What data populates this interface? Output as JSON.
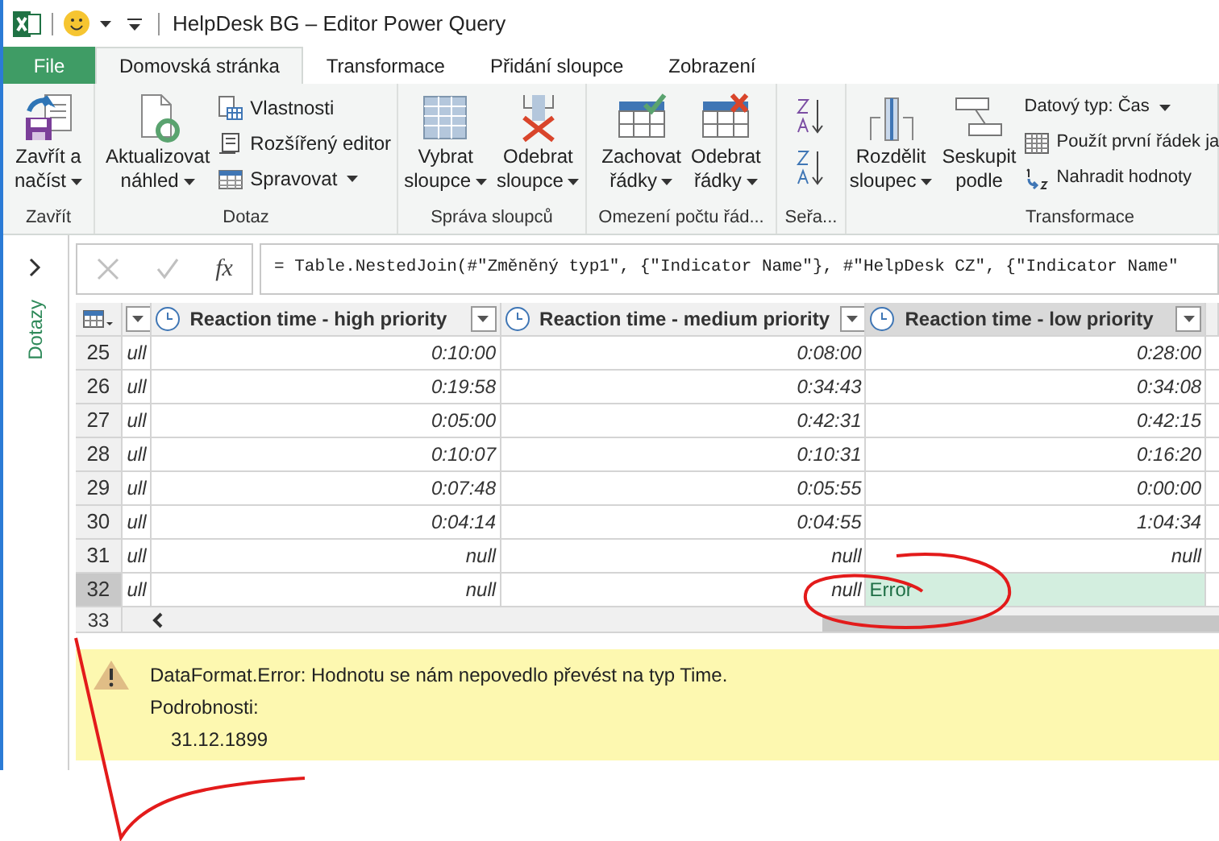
{
  "window": {
    "title": "HelpDesk BG – Editor Power Query"
  },
  "tabs": [
    {
      "label": "File",
      "kind": "file",
      "selected": false
    },
    {
      "label": "Domovská stránka",
      "kind": "tab",
      "selected": true
    },
    {
      "label": "Transformace",
      "kind": "tab",
      "selected": false
    },
    {
      "label": "Přidání sloupce",
      "kind": "tab",
      "selected": false
    },
    {
      "label": "Zobrazení",
      "kind": "tab",
      "selected": false
    }
  ],
  "ribbon": [
    {
      "label": "Zavřít",
      "items": [
        {
          "kind": "large",
          "lines": [
            "Zavřít a",
            "načíst"
          ],
          "dropdown": true
        }
      ]
    },
    {
      "label": "Dotaz",
      "items": [
        {
          "kind": "large",
          "lines": [
            "Aktualizovat",
            "náhled"
          ],
          "dropdown": true
        },
        {
          "kind": "stack",
          "entries": [
            {
              "label": "Vlastnosti",
              "dropdown": false
            },
            {
              "label": "Rozšířený editor",
              "dropdown": false
            },
            {
              "label": "Spravovat",
              "dropdown": true
            }
          ]
        }
      ]
    },
    {
      "label": "Správa sloupců",
      "items": [
        {
          "kind": "large",
          "lines": [
            "Vybrat",
            "sloupce"
          ],
          "dropdown": true
        },
        {
          "kind": "large",
          "lines": [
            "Odebrat",
            "sloupce"
          ],
          "dropdown": true
        }
      ]
    },
    {
      "label": "Omezení počtu řád...",
      "items": [
        {
          "kind": "large",
          "lines": [
            "Zachovat",
            "řádky"
          ],
          "dropdown": true
        },
        {
          "kind": "large",
          "lines": [
            "Odebrat",
            "řádky"
          ],
          "dropdown": true
        }
      ]
    },
    {
      "label": "Seřa...",
      "items": [
        {
          "kind": "sort"
        }
      ]
    },
    {
      "label": "Transformace",
      "items": [
        {
          "kind": "large",
          "lines": [
            "Rozdělit",
            "sloupec"
          ],
          "dropdown": true
        },
        {
          "kind": "large",
          "lines": [
            "Seskupit",
            "podle"
          ],
          "dropdown": false
        },
        {
          "kind": "stack",
          "entries": [
            {
              "label": "Datový typ: Čas",
              "dropdown": true
            },
            {
              "label": "Použít první řádek ja",
              "dropdown": false
            },
            {
              "label": "Nahradit hodnoty",
              "dropdown": false
            }
          ]
        }
      ]
    }
  ],
  "queries_pane": {
    "label": "Dotazy",
    "expanded": false
  },
  "formula_bar": {
    "function_button": "fx",
    "formula": "= Table.NestedJoin(#\"Změněný typ1\", {\"Indicator Name\"}, #\"HelpDesk CZ\", {\"Indicator Name\""
  },
  "table": {
    "columns": [
      {
        "kind": "partial",
        "selected": false
      },
      {
        "kind": "time",
        "label": "Reaction time - high priority",
        "selected": false
      },
      {
        "kind": "time",
        "label": "Reaction time - medium priority",
        "selected": false
      },
      {
        "kind": "time",
        "label": "Reaction time - low priority",
        "selected": true
      },
      {
        "kind": "edge",
        "selected": false
      }
    ],
    "rows": [
      {
        "number": "25",
        "selected": false,
        "cells": [
          {
            "kind": "value",
            "text": "ull"
          },
          {
            "kind": "value",
            "text": "0:10:00"
          },
          {
            "kind": "value",
            "text": "0:08:00"
          },
          {
            "kind": "value",
            "text": "0:28:00"
          }
        ]
      },
      {
        "number": "26",
        "selected": false,
        "cells": [
          {
            "kind": "value",
            "text": "ull"
          },
          {
            "kind": "value",
            "text": "0:19:58"
          },
          {
            "kind": "value",
            "text": "0:34:43"
          },
          {
            "kind": "value",
            "text": "0:34:08"
          }
        ]
      },
      {
        "number": "27",
        "selected": false,
        "cells": [
          {
            "kind": "value",
            "text": "ull"
          },
          {
            "kind": "value",
            "text": "0:05:00"
          },
          {
            "kind": "value",
            "text": "0:42:31"
          },
          {
            "kind": "value",
            "text": "0:42:15"
          }
        ]
      },
      {
        "number": "28",
        "selected": false,
        "cells": [
          {
            "kind": "value",
            "text": "ull"
          },
          {
            "kind": "value",
            "text": "0:10:07"
          },
          {
            "kind": "value",
            "text": "0:10:31"
          },
          {
            "kind": "value",
            "text": "0:16:20"
          }
        ]
      },
      {
        "number": "29",
        "selected": false,
        "cells": [
          {
            "kind": "value",
            "text": "ull"
          },
          {
            "kind": "value",
            "text": "0:07:48"
          },
          {
            "kind": "value",
            "text": "0:05:55"
          },
          {
            "kind": "value",
            "text": "0:00:00"
          }
        ]
      },
      {
        "number": "30",
        "selected": false,
        "cells": [
          {
            "kind": "value",
            "text": "ull"
          },
          {
            "kind": "value",
            "text": "0:04:14"
          },
          {
            "kind": "value",
            "text": "0:04:55"
          },
          {
            "kind": "value",
            "text": "1:04:34"
          }
        ]
      },
      {
        "number": "31",
        "selected": false,
        "cells": [
          {
            "kind": "value",
            "text": "ull"
          },
          {
            "kind": "value",
            "text": "null"
          },
          {
            "kind": "value",
            "text": "null"
          },
          {
            "kind": "value",
            "text": "null"
          }
        ]
      },
      {
        "number": "32",
        "selected": true,
        "cells": [
          {
            "kind": "value",
            "text": "ull"
          },
          {
            "kind": "value",
            "text": "null"
          },
          {
            "kind": "value",
            "text": "null"
          },
          {
            "kind": "error",
            "text": "Error"
          }
        ]
      }
    ],
    "last_row_number": "33"
  },
  "error_panel": {
    "message": "DataFormat.Error: Hodnotu se nám nepovedlo převést na typ Time.",
    "details_label": "Podrobnosti:",
    "details": "31.12.1899"
  }
}
